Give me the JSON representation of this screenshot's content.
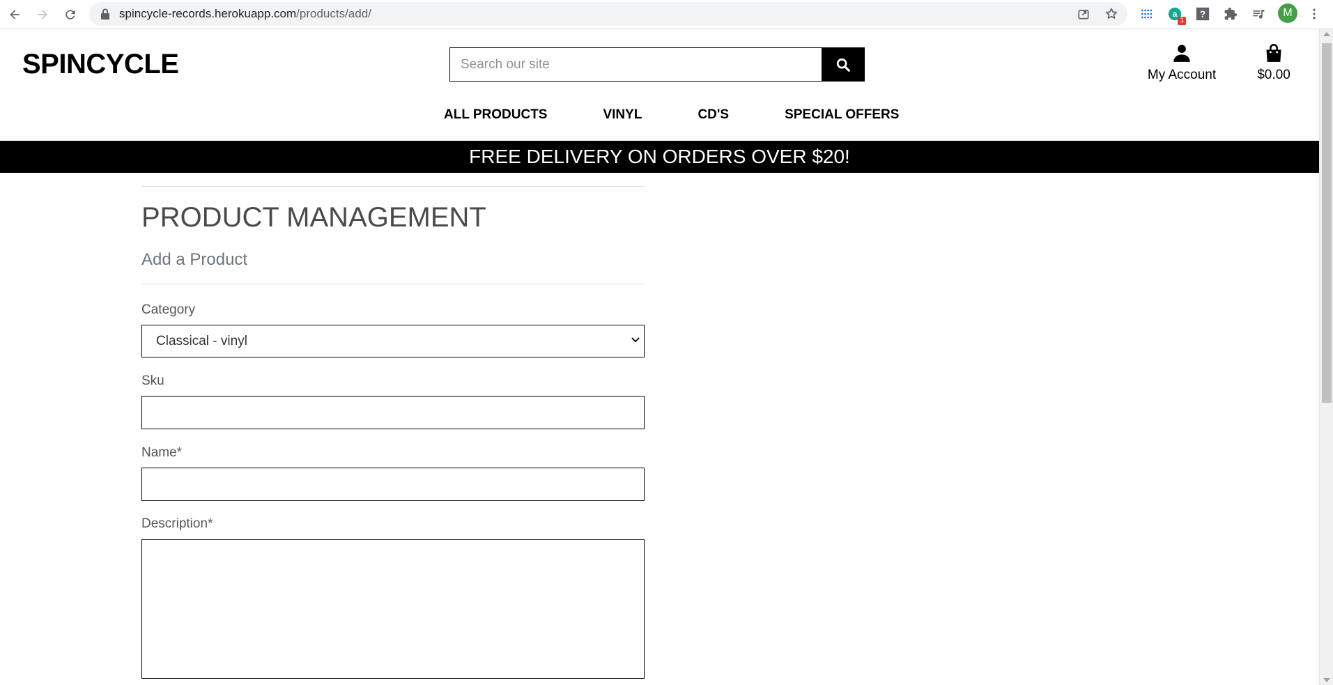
{
  "browser": {
    "url_host": "spincycle-records.herokuapp.com",
    "url_path": "/products/add/",
    "extension_badge": "1",
    "profile_initial": "M"
  },
  "header": {
    "logo": "SPINCYCLE",
    "search_placeholder": "Search our site",
    "account_label": "My Account",
    "bag_total": "$0.00"
  },
  "nav": {
    "items": [
      "ALL PRODUCTS",
      "VINYL",
      "CD'S",
      "SPECIAL OFFERS"
    ]
  },
  "banner": {
    "text": "FREE DELIVERY ON ORDERS OVER $20!"
  },
  "main": {
    "title": "PRODUCT MANAGEMENT",
    "subtitle": "Add a Product",
    "fields": {
      "category_label": "Category",
      "category_value": "Classical - vinyl",
      "sku_label": "Sku",
      "sku_value": "",
      "name_label": "Name*",
      "name_value": "",
      "description_label": "Description*",
      "description_value": ""
    }
  }
}
